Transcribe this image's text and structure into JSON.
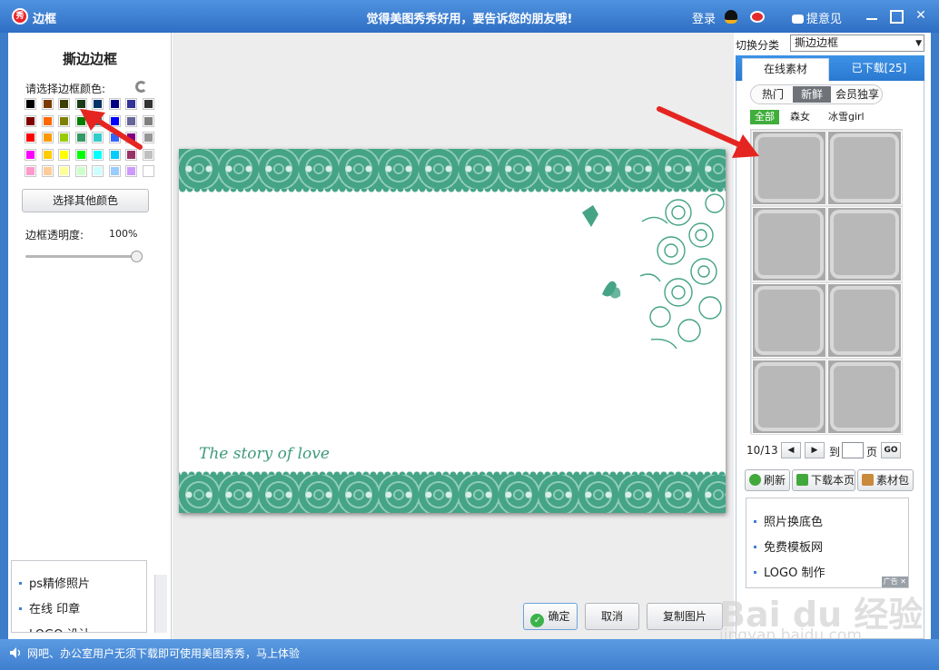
{
  "titlebar": {
    "app_logo": "秀",
    "window_title": "边框",
    "slogan": "觉得美图秀秀好用，要告诉您的朋友哦!",
    "login": "登录",
    "feedback": "提意见",
    "close_glyph": "✕"
  },
  "left_panel": {
    "title": "撕边边框",
    "color_label": "请选择边框颜色:",
    "more_colors_button": "选择其他颜色",
    "opacity_label": "边框透明度:",
    "opacity_value": "100%",
    "opacity_level": 1.0,
    "swatch_colors": [
      [
        "#000000",
        "#7a3a00",
        "#3e3e00",
        "#1a3a1a",
        "#003366",
        "#000080",
        "#333399",
        "#333333"
      ],
      [
        "#800000",
        "#ff6600",
        "#808000",
        "#008000",
        "#008080",
        "#0000ff",
        "#666699",
        "#808080"
      ],
      [
        "#ff0000",
        "#ff9900",
        "#99cc00",
        "#339966",
        "#33cccc",
        "#3366ff",
        "#800080",
        "#969696"
      ],
      [
        "#ff00ff",
        "#ffcc00",
        "#ffff00",
        "#00ff00",
        "#00ffff",
        "#00ccff",
        "#993366",
        "#c0c0c0"
      ],
      [
        "#ff99cc",
        "#ffcc99",
        "#ffff99",
        "#ccffcc",
        "#ccffff",
        "#99ccff",
        "#cc99ff",
        "#ffffff"
      ]
    ],
    "ads": [
      "ps精修照片",
      "在线 印章",
      "LOGO 设计"
    ]
  },
  "canvas": {
    "caption": "The story of love",
    "frame_color": "#45a386"
  },
  "bottom_buttons": {
    "ok": "确定",
    "cancel": "取消",
    "copy": "复制图片"
  },
  "right_panel": {
    "category_label": "切换分类",
    "category_selected": "撕边边框",
    "tab_online": "在线素材",
    "tab_downloaded": "已下载[25]",
    "subtabs": [
      "热门",
      "新鲜",
      "会员独享"
    ],
    "filters": [
      "全部",
      "森女",
      "冰雪girl"
    ],
    "pager": {
      "current": "10/13",
      "goto_label": "到",
      "page_label": "页",
      "go": "GO",
      "prev": "◀",
      "next": "▶"
    },
    "actions": [
      "刷新",
      "下载本页",
      "素材包"
    ],
    "ads": [
      "照片换底色",
      "免费模板网",
      "LOGO 制作"
    ],
    "ad_badge": "广告 ✕"
  },
  "statusbar": {
    "text": "网吧、办公室用户无须下载即可使用美图秀秀，马上体验"
  },
  "watermark": {
    "logo": "Bai du 经验",
    "url": "jingyan.baidu.com"
  },
  "colors": {
    "titlebar": "#3b7ed4",
    "accent_blue": "#2a79d0",
    "arrow_red": "#e52521",
    "selected_green": "#3fae3b"
  }
}
